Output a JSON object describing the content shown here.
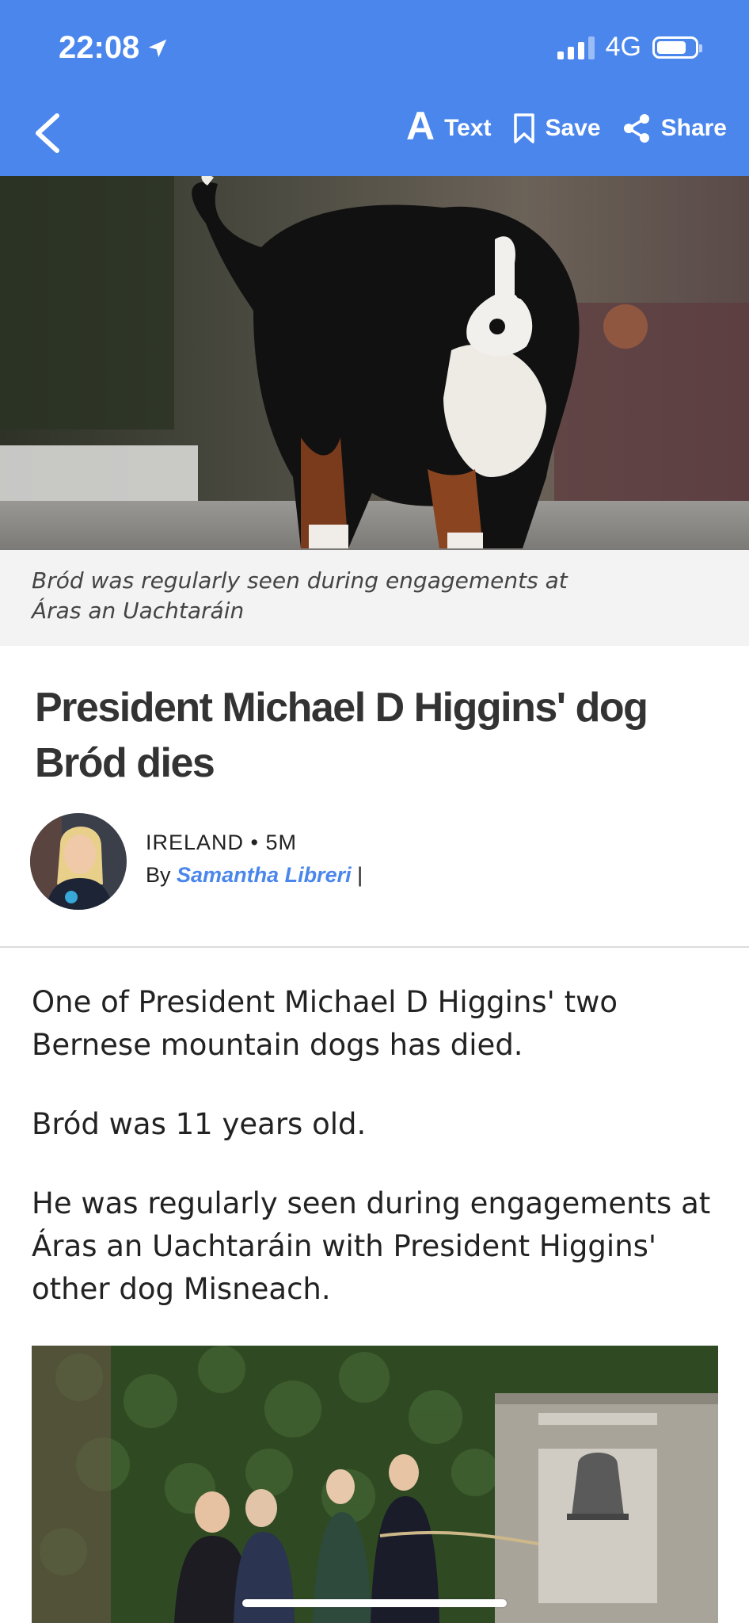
{
  "status_bar": {
    "time": "22:08",
    "network": "4G",
    "battery_level": 0.7
  },
  "toolbar": {
    "back_icon": "chevron-left-icon",
    "text_icon_glyph": "A",
    "text_label": "Text",
    "save_label": "Save",
    "share_label": "Share"
  },
  "hero": {
    "caption": "Bród was regularly seen during engagements at Áras an Uachtaráin"
  },
  "article": {
    "headline": "President Michael D Higgins' dog Bród dies",
    "section": "IRELAND",
    "separator": "•",
    "age": "5M",
    "by_prefix": "By",
    "author": "Samantha Libreri",
    "author_suffix": "|",
    "paragraphs": [
      "One of President Michael D Higgins' two Bernese mountain dogs has died.",
      "Bród was 11 years old.",
      "He was regularly seen during engagements at Áras an Uachtaráin with President Higgins' other dog Misneach."
    ]
  },
  "colors": {
    "brand": "#4a86ec",
    "caption_bg": "#f3f3f3",
    "text": "#222222"
  }
}
